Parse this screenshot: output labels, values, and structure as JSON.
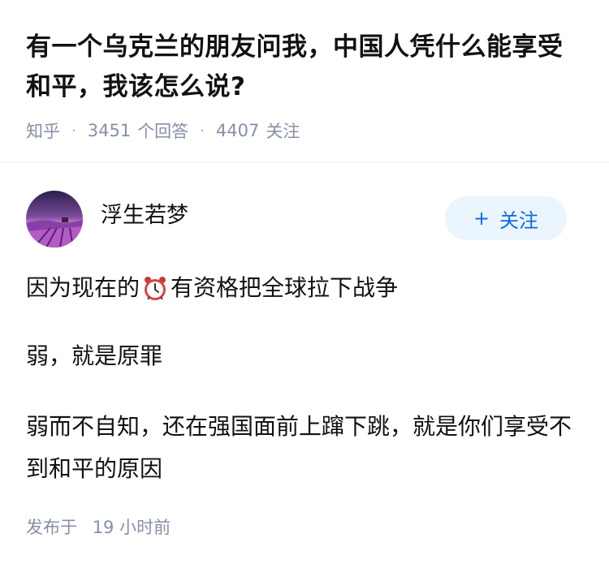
{
  "question": {
    "title": "有一个乌克兰的朋友问我，中国人凭什么能享受和平，我该怎么说?",
    "source": "知乎",
    "answer_count": "3451",
    "answer_label": "个回答",
    "follower_count": "4407",
    "follower_label": "关注"
  },
  "answer": {
    "author_name": "浮生若梦",
    "follow_label": "关注",
    "follow_icon": "plus-icon",
    "para1_before": "因为现在的",
    "para1_emoji": "alarm-clock-icon",
    "para1_after": "有资格把全球拉下战争",
    "para2": "弱，就是原罪",
    "para3": "弱而不自知，还在强国面前上蹿下跳，就是你们享受不到和平的原因",
    "publish_label": "发布于",
    "publish_time": "19 小时前"
  },
  "colors": {
    "accent": "#056de8",
    "follow_bg": "#ebf5fd",
    "meta": "#8590a6"
  }
}
